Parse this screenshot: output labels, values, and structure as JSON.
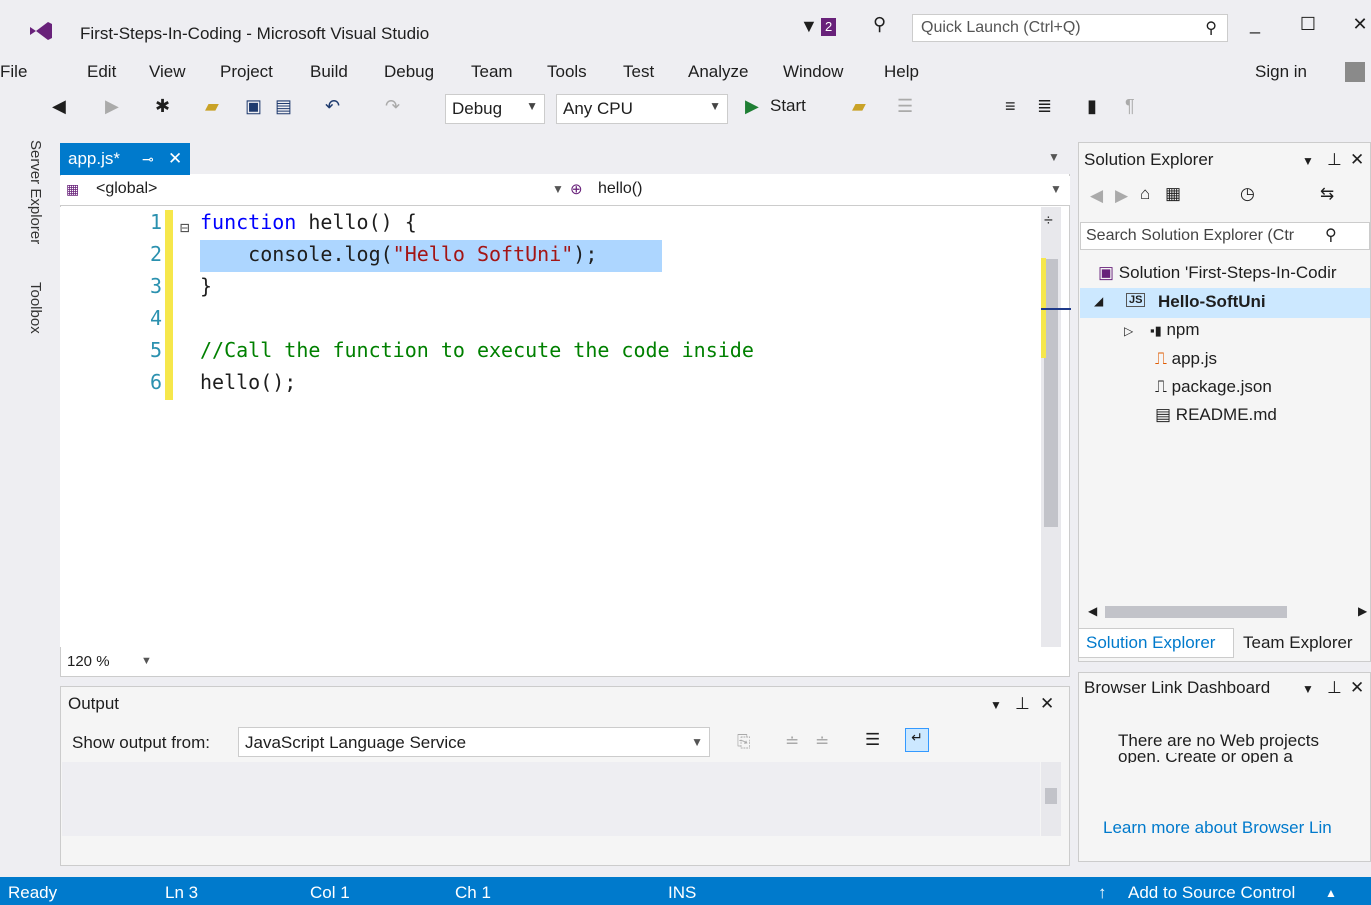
{
  "window": {
    "title": "First-Steps-In-Coding - Microsoft Visual Studio",
    "notification_count": "2",
    "quick_launch_placeholder": "Quick Launch (Ctrl+Q)"
  },
  "menu": [
    "File",
    "Edit",
    "View",
    "Project",
    "Build",
    "Debug",
    "Team",
    "Tools",
    "Test",
    "Analyze",
    "Window",
    "Help"
  ],
  "sign_in": "Sign in",
  "toolbar": {
    "config": "Debug",
    "platform": "Any CPU",
    "start_label": "Start"
  },
  "side_tabs": [
    "Server Explorer",
    "Toolbox"
  ],
  "editor": {
    "tab_label": "app.js*",
    "nav_scope": "<global>",
    "nav_member": "hello()",
    "lines": [
      {
        "num": "1",
        "parts": [
          {
            "t": "function",
            "c": "kw"
          },
          {
            "t": " hello() {",
            "c": ""
          }
        ]
      },
      {
        "num": "2",
        "parts": [
          {
            "t": "    console.log(",
            "c": ""
          },
          {
            "t": "\"Hello SoftUni\"",
            "c": "str"
          },
          {
            "t": ");",
            "c": ""
          }
        ]
      },
      {
        "num": "3",
        "parts": [
          {
            "t": "}",
            "c": ""
          }
        ]
      },
      {
        "num": "4",
        "parts": []
      },
      {
        "num": "5",
        "parts": [
          {
            "t": "//Call the function to execute the code inside",
            "c": "cmt"
          }
        ]
      },
      {
        "num": "6",
        "parts": [
          {
            "t": "hello();",
            "c": ""
          }
        ]
      }
    ],
    "zoom": "120 %"
  },
  "output": {
    "title": "Output",
    "show_from_label": "Show output from:",
    "source": "JavaScript Language Service"
  },
  "solution_explorer": {
    "title": "Solution Explorer",
    "search_placeholder": "Search Solution Explorer (Ctr",
    "solution": "Solution 'First-Steps-In-Codir",
    "project": "Hello-SoftUni",
    "items": [
      "npm",
      "app.js",
      "package.json",
      "README.md"
    ],
    "tab_solution": "Solution Explorer",
    "tab_team": "Team Explorer"
  },
  "browser_link": {
    "title": "Browser Link Dashboard",
    "message": "There are no Web projects",
    "message_cut": "open. Create or open a",
    "link": "Learn more about Browser Lin"
  },
  "status": {
    "state": "Ready",
    "line": "Ln 3",
    "col": "Col 1",
    "ch": "Ch 1",
    "mode": "INS",
    "source_control": "Add to Source Control"
  },
  "colors": {
    "accent": "#007acc",
    "keyword": "#0000ff",
    "string": "#a31515",
    "comment": "#008000",
    "line_number": "#2b91af",
    "selection": "#add6ff"
  }
}
